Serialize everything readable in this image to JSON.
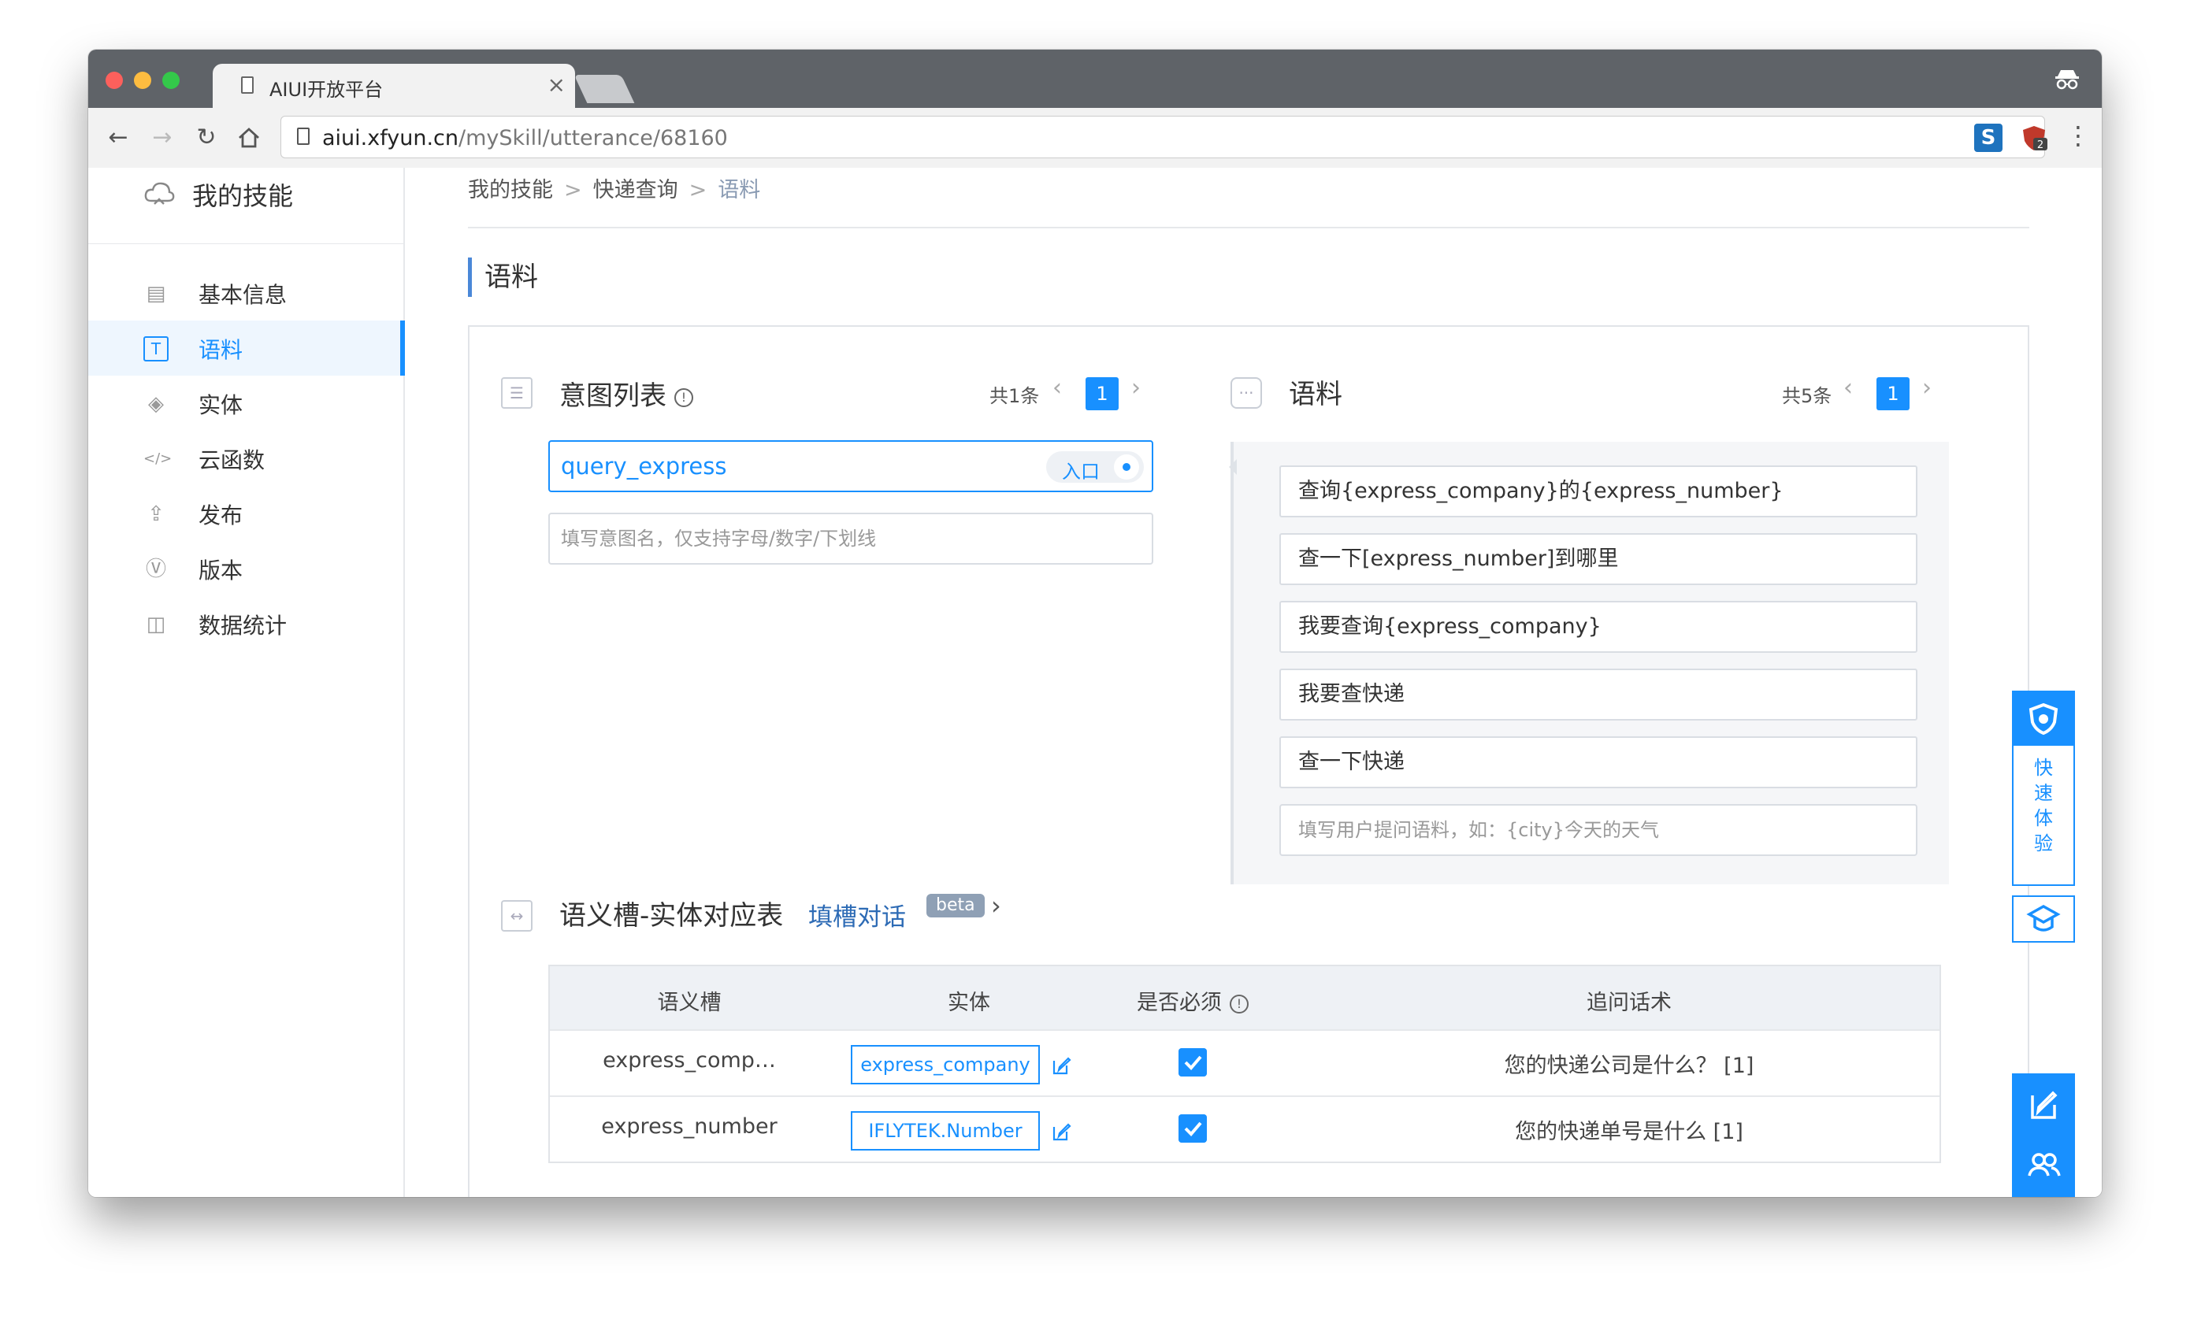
{
  "browser": {
    "tab_title": "AIUI开放平台",
    "tab_close": "×",
    "url_host": "aiui.xfyun.cn",
    "url_path": "/mySkill/utterance/68160",
    "ext1_label": "S",
    "ext2_badge": "2"
  },
  "sidebar": {
    "header": "我的技能",
    "items": [
      {
        "label": "基本信息",
        "icon": "doc-icon",
        "glyph": "▤"
      },
      {
        "label": "语料",
        "icon": "text-icon",
        "glyph": "T"
      },
      {
        "label": "实体",
        "icon": "cube-icon",
        "glyph": "◈"
      },
      {
        "label": "云函数",
        "icon": "code-icon",
        "glyph": "</>"
      },
      {
        "label": "发布",
        "icon": "upload-icon",
        "glyph": "⇪"
      },
      {
        "label": "版本",
        "icon": "version-icon",
        "glyph": "Ⓥ"
      },
      {
        "label": "数据统计",
        "icon": "chart-icon",
        "glyph": "◫"
      }
    ],
    "active_index": 1
  },
  "breadcrumb": {
    "items": [
      "我的技能",
      "快递查询",
      "语料"
    ],
    "separator": ">"
  },
  "section_title": "语料",
  "intent_panel": {
    "title": "意图列表",
    "count": "共1条",
    "page": "1",
    "selected_intent": "query_express",
    "entry_label": "入口",
    "new_intent_placeholder": "填写意图名，仅支持字母/数字/下划线"
  },
  "utterance_panel": {
    "title": "语料",
    "count": "共5条",
    "page": "1",
    "utterances": [
      "查询{express_company}的{express_number}",
      "查一下[express_number]到哪里",
      "我要查询{express_company}",
      "我要查快递",
      "查一下快递"
    ],
    "new_utterance_placeholder": "填写用户提问语料，如：{city}今天的天气"
  },
  "slot_table": {
    "title": "语义槽-实体对应表",
    "link": "填槽对话",
    "beta": "beta",
    "headers": [
      "语义槽",
      "实体",
      "是否必须",
      "追问话术"
    ],
    "rows": [
      {
        "slot": "express_comp…",
        "entity": "express_company",
        "required": true,
        "prompt": "您的快递公司是什么？ [1]"
      },
      {
        "slot": "express_number",
        "entity": "IFLYTEK.Number",
        "required": true,
        "prompt": "您的快递单号是什么 [1]"
      }
    ]
  },
  "floating": {
    "quick_try": "快速体验"
  },
  "colors": {
    "accent": "#1890ff",
    "titlebar": "#5f6368",
    "link": "#2d6bb5"
  }
}
